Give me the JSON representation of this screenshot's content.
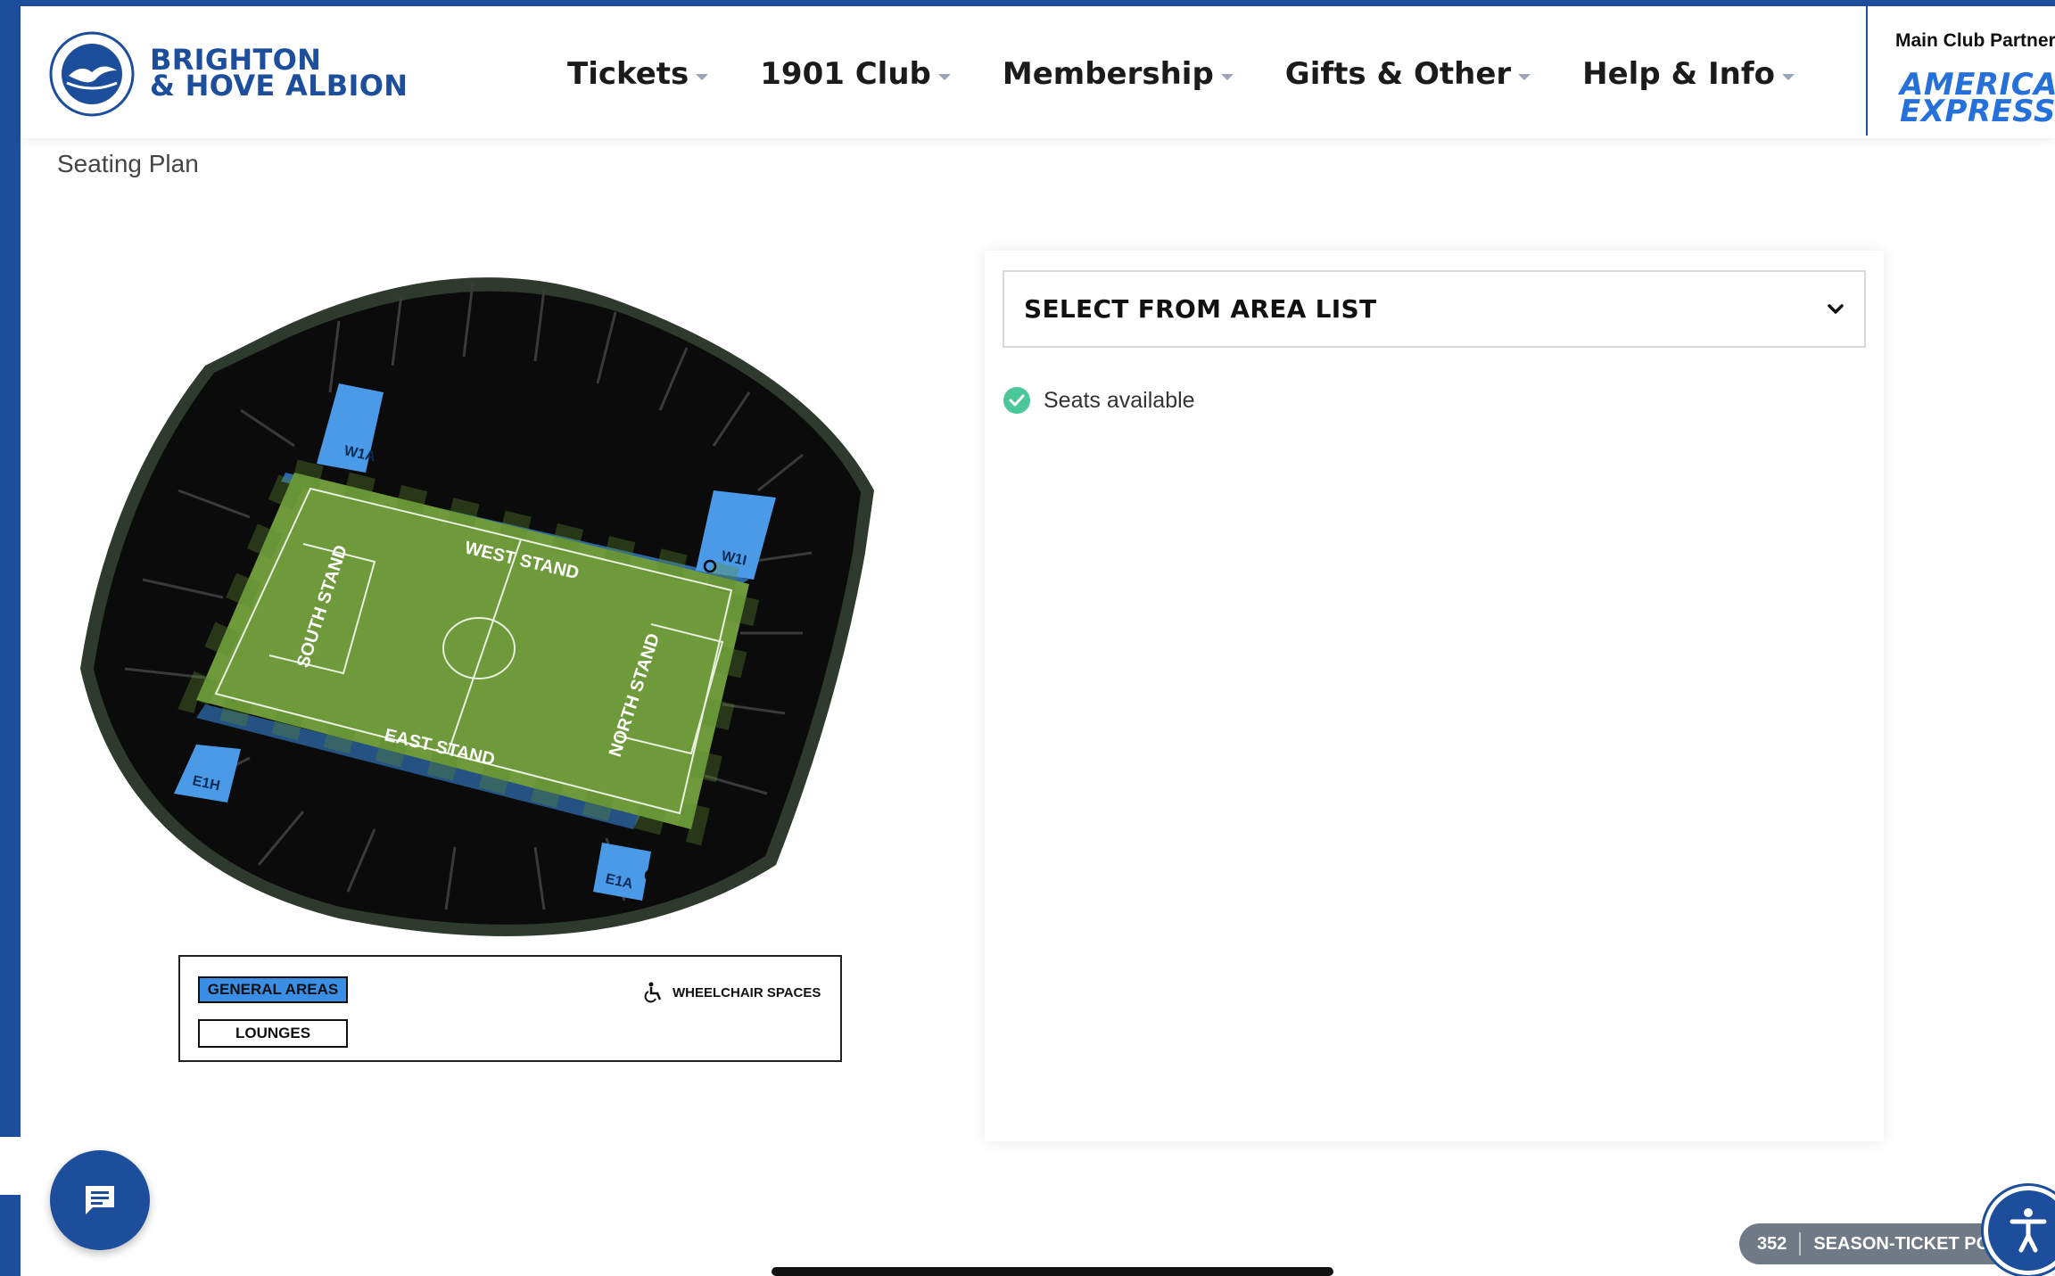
{
  "header": {
    "brand_line1": "BRIGHTON",
    "brand_line2": "& HOVE ALBION",
    "nav": [
      {
        "label": "Tickets"
      },
      {
        "label": "1901 Club"
      },
      {
        "label": "Membership"
      },
      {
        "label": "Gifts & Other"
      },
      {
        "label": "Help & Info"
      }
    ],
    "partner_label": "Main Club Partner",
    "partner_logo_line1": "AMERICAN",
    "partner_logo_line2": "EXPRESS"
  },
  "page": {
    "title": "Seating Plan"
  },
  "stadium": {
    "stands": {
      "west": "WEST STAND",
      "east": "EAST STAND",
      "north": "NORTH STAND",
      "south": "SOUTH STAND"
    },
    "areas": [
      "W1A",
      "W1I",
      "E1H",
      "E1A"
    ]
  },
  "legend": {
    "general": "GENERAL AREAS",
    "lounges": "LOUNGES",
    "wheelchair": "WHEELCHAIR SPACES"
  },
  "panel": {
    "select_label": "SELECT FROM AREA LIST",
    "availability": "Seats available"
  },
  "footer": {
    "season_count": "352",
    "season_label": "SEASON-TICKET PO"
  },
  "icons": {
    "chat": "chat-icon",
    "accessibility": "accessibility-icon",
    "check": "check-circle-icon",
    "chevron": "chevron-down-icon",
    "wheelchair": "wheelchair-icon"
  },
  "colors": {
    "brand_blue": "#1c4e9c",
    "general_area_blue": "#3b8ee6",
    "available_green": "#4cc79a",
    "pitch_green": "#6f9a3c"
  }
}
